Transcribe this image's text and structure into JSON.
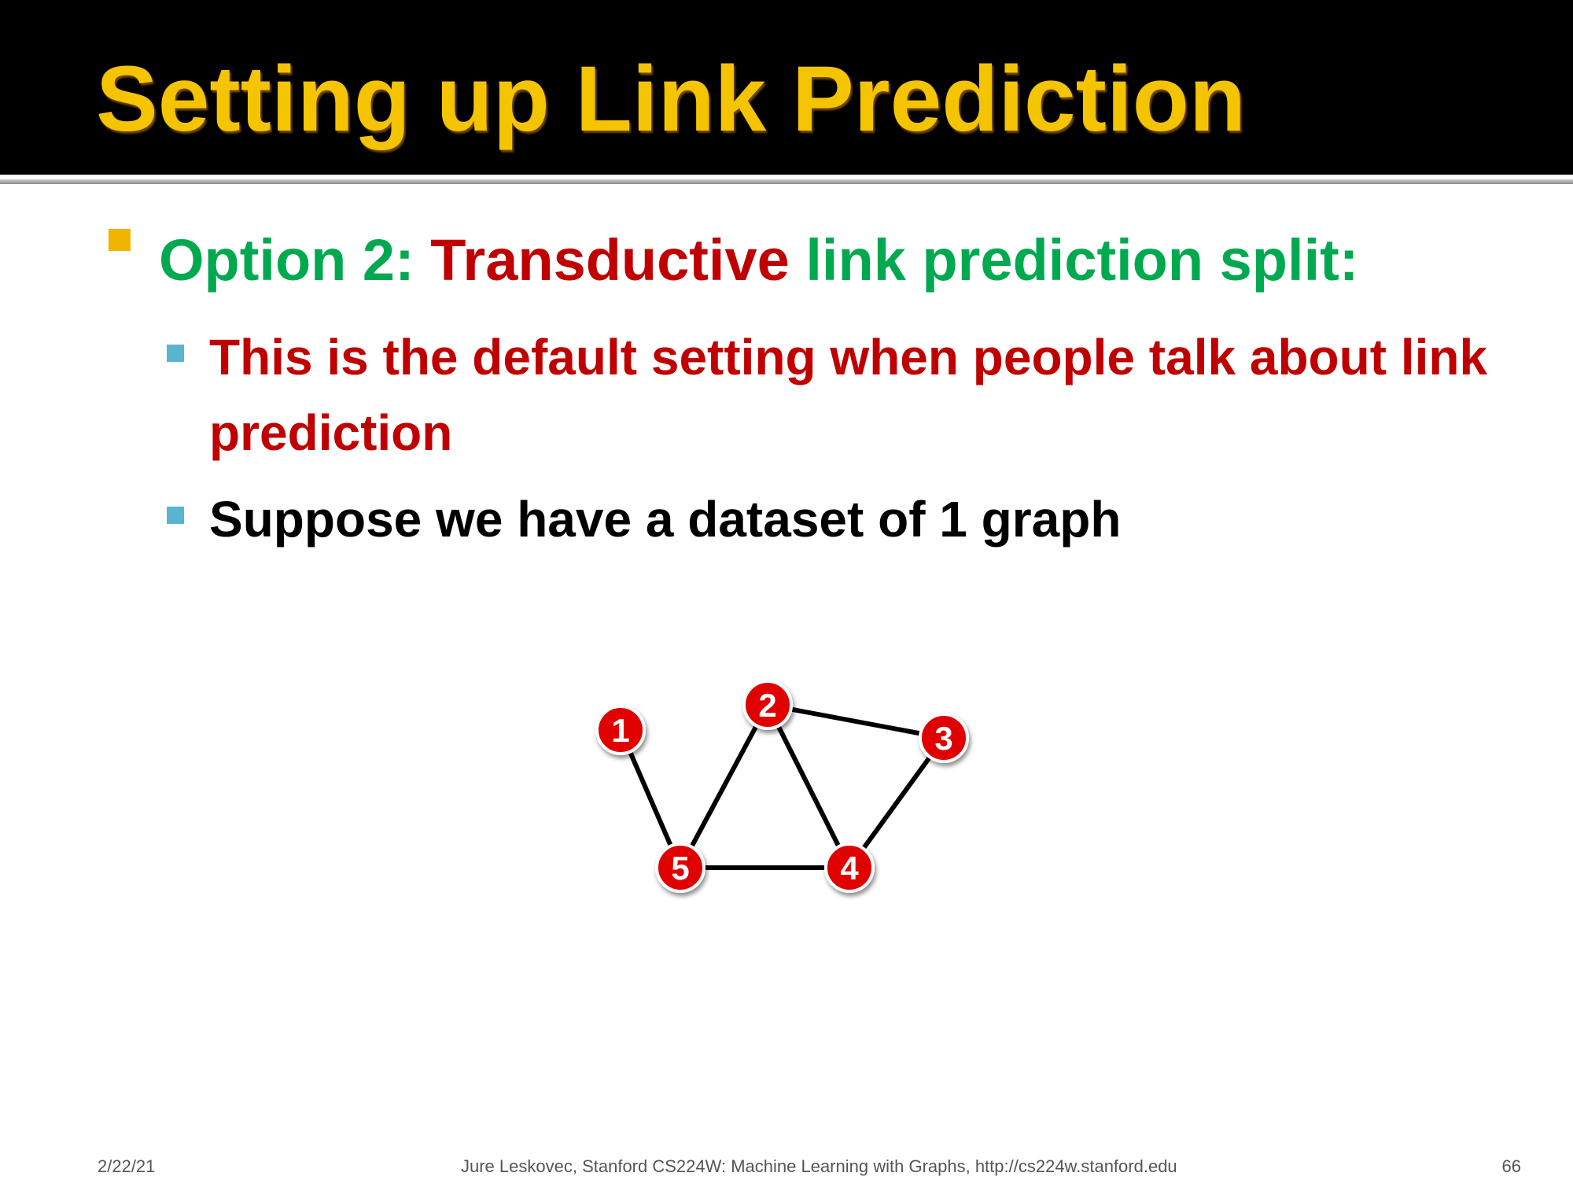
{
  "slide": {
    "title": "Setting up Link Prediction"
  },
  "bullets": {
    "level1": {
      "prefix": "Option 2: ",
      "highlight": "Transductive",
      "suffix": " link prediction split:"
    },
    "level2": [
      "This is the default setting when people talk about link prediction",
      "Suppose we have a dataset of 1 graph"
    ]
  },
  "graph": {
    "nodes": [
      {
        "id": "1",
        "label": "1"
      },
      {
        "id": "2",
        "label": "2"
      },
      {
        "id": "3",
        "label": "3"
      },
      {
        "id": "4",
        "label": "4"
      },
      {
        "id": "5",
        "label": "5"
      }
    ],
    "edges": [
      {
        "source": "1",
        "target": "5"
      },
      {
        "source": "5",
        "target": "2"
      },
      {
        "source": "2",
        "target": "3"
      },
      {
        "source": "2",
        "target": "4"
      },
      {
        "source": "3",
        "target": "4"
      },
      {
        "source": "5",
        "target": "4"
      }
    ],
    "colors": {
      "node_fill": "#e00000",
      "node_stroke": "#ffffff",
      "node_label": "#ffffff",
      "edge": "#000000"
    }
  },
  "footer": {
    "date": "2/22/21",
    "credit": "Jure Leskovec, Stanford CS224W: Machine Learning with Graphs, http://cs224w.stanford.edu",
    "page_number": "66"
  },
  "colors": {
    "title": "#f5c400",
    "title_bar": "#000000",
    "green_text": "#00a94f",
    "red_text": "#c00000",
    "level1_marker": "#f0b400",
    "level2_marker": "#5bb4cf"
  }
}
